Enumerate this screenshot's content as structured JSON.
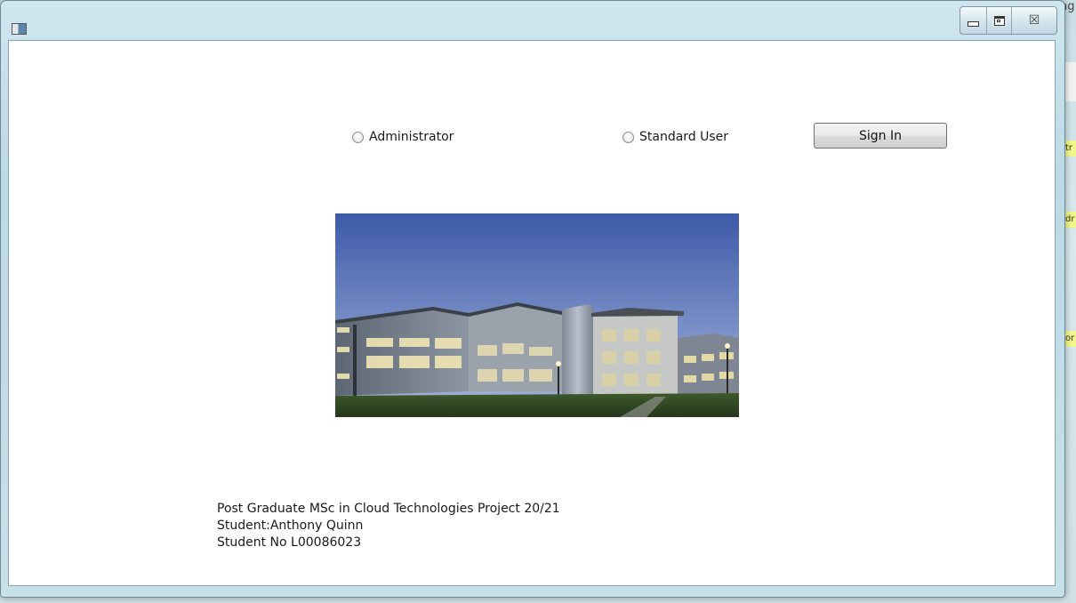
{
  "background": {
    "corner_text": "ng",
    "highlights": [
      "tr",
      "dr",
      "or"
    ]
  },
  "window": {
    "app_icon": "window-app-icon",
    "caption": {
      "minimize_icon": "minimize-icon",
      "maximize_icon": "maximize-icon",
      "close_icon": "close-icon",
      "close_glyph": "☒"
    }
  },
  "login": {
    "roles": [
      {
        "label": "Administrator",
        "checked": false
      },
      {
        "label": "Standard User",
        "checked": false
      }
    ],
    "sign_in_label": "Sign In"
  },
  "image": {
    "subject": "campus-building-photo"
  },
  "footer": {
    "line1": "Post Graduate MSc in Cloud Technologies Project 20/21",
    "line2": "Student:Anthony Quinn",
    "line3": "Student No L00086023"
  }
}
